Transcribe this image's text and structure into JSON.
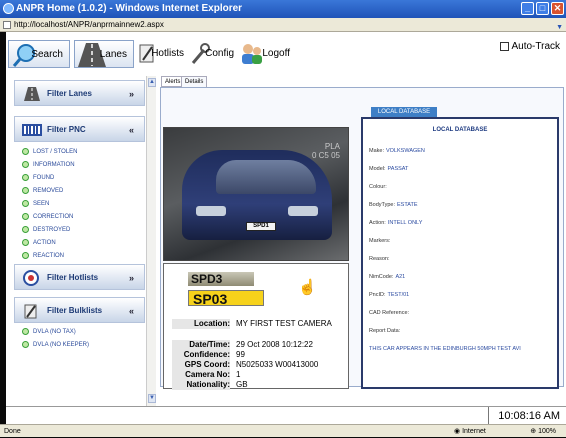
{
  "window": {
    "title": "ANPR Home (1.0.2) - Windows Internet Explorer",
    "url": "http://localhost/ANPR/anprmainnew2.aspx"
  },
  "toolbar": {
    "search": "Search",
    "lanes": "Lanes",
    "hotlists": "Hotlists",
    "config": "Config",
    "logoff": "Logoff",
    "autotrack": "Auto-Track"
  },
  "sidebar": {
    "filter_lanes": "Filter Lanes",
    "filter_pnc": "Filter PNC",
    "pnc_items": [
      "LOST / STOLEN",
      "INFORMATION",
      "FOUND",
      "REMOVED",
      "SEEN",
      "CORRECTION",
      "DESTROYED",
      "ACTION",
      "REACTION"
    ],
    "filter_hotlists": "Filter Hotlists",
    "filter_bulklists": "Filter Bulklists",
    "bulk_items": [
      "DVLA (NO TAX)",
      "DVLA (NO KEEPER)"
    ]
  },
  "tabs": {
    "alerts": "Alerts",
    "details": "Details"
  },
  "capture": {
    "plate_text": "SPD3",
    "overlay_line1": "PLA",
    "overlay_line2": "0 C5 05",
    "plate_small": "SPD1",
    "ocr_plate": "SPD3",
    "ocr_plate_yellow": "SP03"
  },
  "details": {
    "location_label": "Location:",
    "location": "MY FIRST TEST CAMERA",
    "datetime_label": "Date/Time:",
    "datetime": "29 Oct 2008 10:12:22",
    "confidence_label": "Confidence:",
    "confidence": "99",
    "gps_label": "GPS Coord:",
    "gps": "N5025033 W00413000",
    "camera_label": "Camera No:",
    "camera": "1",
    "nationality_label": "Nationality:",
    "nationality": "GB"
  },
  "db": {
    "tab": "LOCAL DATABASE",
    "title": "LOCAL DATABASE",
    "rows": [
      {
        "k": "Make:",
        "v": "VOLKSWAGEN"
      },
      {
        "k": "Model:",
        "v": "PASSAT"
      },
      {
        "k": "Colour:",
        "v": ""
      },
      {
        "k": "BodyType:",
        "v": "ESTATE"
      },
      {
        "k": "Action:",
        "v": "INTELL ONLY"
      },
      {
        "k": "Markers:",
        "v": ""
      },
      {
        "k": "Reason:",
        "v": ""
      },
      {
        "k": "NimCode:",
        "v": "A21"
      },
      {
        "k": "PncID:",
        "v": "TEST/01"
      },
      {
        "k": "CAD Reference:",
        "v": ""
      },
      {
        "k": "Report Data:",
        "v": ""
      }
    ],
    "report": "THIS CAR APPEARS IN THE EDINBURGH 50MPH TEST AVI"
  },
  "status": {
    "clock": "10:08:16 AM",
    "done": "Done",
    "zone": "Internet",
    "zoom": "100%"
  }
}
